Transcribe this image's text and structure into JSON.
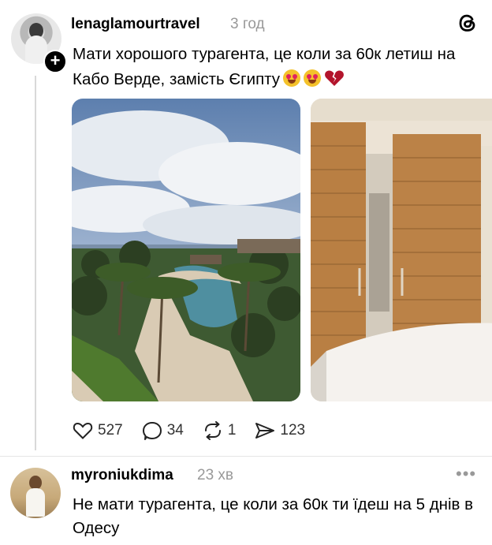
{
  "post": {
    "username": "lenaglamourtravel",
    "time": "3 год",
    "text": "Мати хорошого турагента, це коли за 60к летиш на Кабо Верде, замість Єгипту",
    "emojis": [
      "heart-eyes-emoji",
      "heart-eyes-emoji",
      "broken-heart-emoji"
    ],
    "actions": {
      "likes": "527",
      "comments": "34",
      "reposts": "1",
      "shares": "123"
    }
  },
  "reply": {
    "username": "myroniukdima",
    "time": "23 хв",
    "text": "Не мати турагента, це коли за 60к ти їдеш на 5 днів в Одесу"
  },
  "colors": {
    "text": "#000000",
    "muted": "#999999",
    "divider": "#e5e5e5",
    "thread_line": "#d9d9d9"
  }
}
